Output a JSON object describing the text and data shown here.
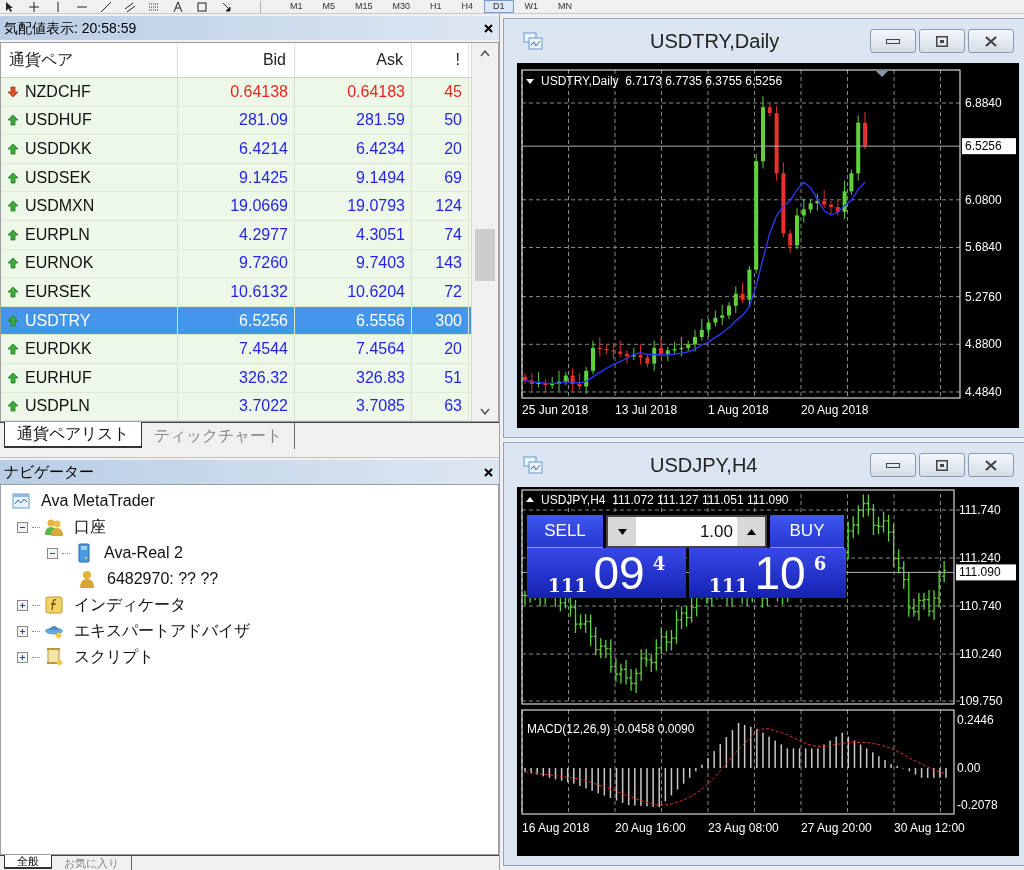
{
  "toolbar": {
    "timeframes": [
      {
        "label": "M1",
        "selected": false
      },
      {
        "label": "M5",
        "selected": false
      },
      {
        "label": "M15",
        "selected": false
      },
      {
        "label": "M30",
        "selected": false
      },
      {
        "label": "H1",
        "selected": false
      },
      {
        "label": "H4",
        "selected": false
      },
      {
        "label": "D1",
        "selected": true
      },
      {
        "label": "W1",
        "selected": false
      },
      {
        "label": "MN",
        "selected": false
      }
    ]
  },
  "market_watch": {
    "title": "気配値表示: 20:58:59",
    "columns": [
      "通貨ペア",
      "Bid",
      "Ask",
      "!"
    ],
    "rows": [
      {
        "symbol": "NZDCHF",
        "bid": "0.64138",
        "ask": "0.64183",
        "spread": "45",
        "kind": "down",
        "selected": false
      },
      {
        "symbol": "USDHUF",
        "bid": "281.09",
        "ask": "281.59",
        "spread": "50",
        "kind": "up",
        "selected": false
      },
      {
        "symbol": "USDDKK",
        "bid": "6.4214",
        "ask": "6.4234",
        "spread": "20",
        "kind": "up",
        "selected": false
      },
      {
        "symbol": "USDSEK",
        "bid": "9.1425",
        "ask": "9.1494",
        "spread": "69",
        "kind": "up",
        "selected": false
      },
      {
        "symbol": "USDMXN",
        "bid": "19.0669",
        "ask": "19.0793",
        "spread": "124",
        "kind": "up",
        "selected": false
      },
      {
        "symbol": "EURPLN",
        "bid": "4.2977",
        "ask": "4.3051",
        "spread": "74",
        "kind": "up",
        "selected": false
      },
      {
        "symbol": "EURNOK",
        "bid": "9.7260",
        "ask": "9.7403",
        "spread": "143",
        "kind": "up",
        "selected": false
      },
      {
        "symbol": "EURSEK",
        "bid": "10.6132",
        "ask": "10.6204",
        "spread": "72",
        "kind": "up",
        "selected": false
      },
      {
        "symbol": "USDTRY",
        "bid": "6.5256",
        "ask": "6.5556",
        "spread": "300",
        "kind": "up",
        "selected": true
      },
      {
        "symbol": "EURDKK",
        "bid": "7.4544",
        "ask": "7.4564",
        "spread": "20",
        "kind": "up",
        "selected": false
      },
      {
        "symbol": "EURHUF",
        "bid": "326.32",
        "ask": "326.83",
        "spread": "51",
        "kind": "up",
        "selected": false
      },
      {
        "symbol": "USDPLN",
        "bid": "3.7022",
        "ask": "3.7085",
        "spread": "63",
        "kind": "up",
        "selected": false
      }
    ],
    "tabs": [
      {
        "label": "通貨ペアリスト",
        "selected": true
      },
      {
        "label": "ティックチャート",
        "selected": false
      }
    ]
  },
  "navigator": {
    "title": "ナビゲーター",
    "tree": [
      {
        "label": "Ava MetaTrader",
        "kind": "terminal",
        "children": [
          {
            "label": "口座",
            "kind": "accounts",
            "expanded": true,
            "children": [
              {
                "label": "Ava-Real 2",
                "kind": "server",
                "expanded": true,
                "children": [
                  {
                    "label": "6482970: ?? ??",
                    "kind": "account"
                  }
                ]
              }
            ]
          },
          {
            "label": "インディケータ",
            "kind": "indicator",
            "expanded": false
          },
          {
            "label": "エキスパートアドバイザ",
            "kind": "expert",
            "expanded": false
          },
          {
            "label": "スクリプト",
            "kind": "script",
            "expanded": false
          }
        ]
      }
    ],
    "tabs": [
      {
        "label": "全般",
        "selected": true
      },
      {
        "label": "お気に入り",
        "selected": false
      }
    ]
  },
  "charts": [
    {
      "title": "USDTRY,Daily",
      "kind": "candles",
      "legend": {
        "text": "USDTRY,Daily  6.7173 6.7735 6.3755 6.5256",
        "expanded": true
      },
      "price_ticks": [
        "6.8840",
        "6.0800",
        "5.6840",
        "5.2760",
        "4.8800",
        "4.4840"
      ],
      "current_price": "6.5256",
      "time_labels": [
        "25 Jun 2018",
        "13 Jul 2018",
        "1 Aug 2018",
        "20 Aug 2018"
      ]
    },
    {
      "title": "USDJPY,H4",
      "kind": "bars",
      "legend": {
        "text": "USDJPY,H4  111.072 111.127 111.051 111.090",
        "expanded": false
      },
      "price_ticks": [
        "111.740",
        "111.240",
        "110.740",
        "110.240",
        "109.750"
      ],
      "current_price": "111.090",
      "time_labels": [
        "16 Aug 2018",
        "20 Aug 16:00",
        "23 Aug 08:00",
        "27 Aug 20:00",
        "30 Aug 12:00"
      ],
      "trade_panel": {
        "sell_label": "SELL",
        "buy_label": "BUY",
        "lot": "1.00",
        "sell_price": {
          "big": "111",
          "pips": "09",
          "point": "4"
        },
        "buy_price": {
          "big": "111",
          "pips": "10",
          "point": "6"
        }
      },
      "macd": {
        "legend": "MACD(12,26,9) -0.0458 0.0090",
        "chart_data": {
          "type": "bar",
          "ylim": [
            -0.235,
            0.296
          ],
          "yticks": [
            {
              "value": 0.2446,
              "label": "0.2446"
            },
            {
              "value": 0,
              "label": "0.00"
            },
            {
              "value": -0.2078,
              "label": "-0.2078"
            }
          ],
          "series": [
            {
              "color": "#c8c8c8",
              "values": [
                -0.02,
                -0.028,
                -0.035,
                -0.043,
                -0.05,
                -0.058,
                -0.065,
                -0.073,
                -0.08,
                -0.092,
                -0.104,
                -0.117,
                -0.129,
                -0.141,
                -0.153,
                -0.166,
                -0.178,
                -0.19,
                -0.192,
                -0.194,
                -0.196,
                -0.198,
                -0.2,
                -0.17,
                -0.14,
                -0.11,
                -0.08,
                -0.05,
                -0.017,
                0.017,
                0.05,
                0.086,
                0.122,
                0.158,
                0.194,
                0.23,
                0.22,
                0.21,
                0.2,
                0.18,
                0.16,
                0.14,
                0.12,
                0.1,
                0.1,
                0.1,
                0.1,
                0.1,
                0.1,
                0.12,
                0.14,
                0.16,
                0.18,
                0.16,
                0.14,
                0.12,
                0.1,
                0.08,
                0.06,
                0.04,
                0.02,
                0.01,
                0,
                -0.017,
                -0.033,
                -0.05,
                -0.05,
                -0.05,
                -0.05,
                -0.05
              ]
            },
            {
              "color": "#e03020",
              "type": "line",
              "line_style": "dashed",
              "values": [
                -0.02,
                -0.024,
                -0.028,
                -0.032,
                -0.035,
                -0.039,
                -0.043,
                -0.047,
                -0.05,
                -0.058,
                -0.066,
                -0.076,
                -0.086,
                -0.097,
                -0.107,
                -0.119,
                -0.131,
                -0.143,
                -0.155,
                -0.166,
                -0.176,
                -0.185,
                -0.191,
                -0.189,
                -0.184,
                -0.176,
                -0.163,
                -0.148,
                -0.13,
                -0.109,
                -0.082,
                -0.05,
                -0.015,
                0.022,
                0.059,
                0.095,
                0.128,
                0.158,
                0.184,
                0.2,
                0.2,
                0.19,
                0.18,
                0.17,
                0.155,
                0.14,
                0.125,
                0.115,
                0.11,
                0.11,
                0.115,
                0.12,
                0.125,
                0.13,
                0.13,
                0.13,
                0.13,
                0.125,
                0.12,
                0.11,
                0.1,
                0.085,
                0.07,
                0.05,
                0.035,
                0.02,
                0.005,
                -0.01,
                -0.02,
                -0.03
              ]
            }
          ]
        }
      }
    }
  ]
}
